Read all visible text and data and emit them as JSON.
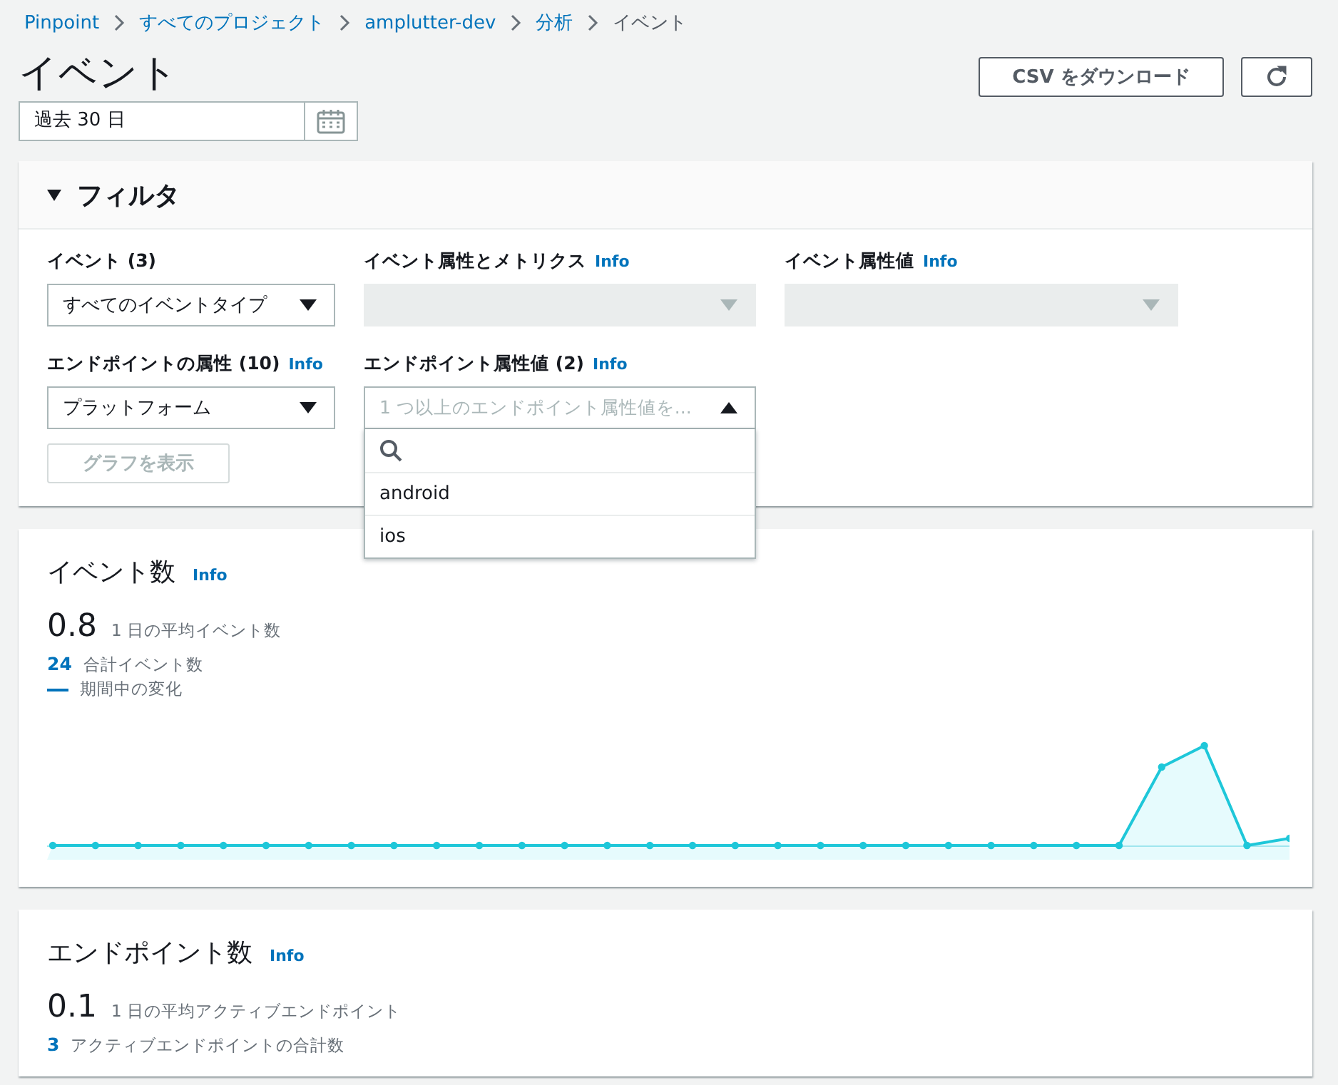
{
  "breadcrumb": [
    {
      "label": "Pinpoint",
      "link": true
    },
    {
      "label": "すべてのプロジェクト",
      "link": true
    },
    {
      "label": "amplutter-dev",
      "link": true
    },
    {
      "label": "分析",
      "link": true
    },
    {
      "label": "イベント",
      "link": false
    }
  ],
  "page_title": "イベント",
  "header_buttons": {
    "download": "CSV をダウンロード"
  },
  "date_range": {
    "value": "過去 30 日"
  },
  "filter": {
    "title": "フィルタ",
    "expanded": true,
    "fields": [
      {
        "label": "イベント (3)",
        "value": "すべてのイベントタイプ",
        "disabled": false
      },
      {
        "label": "イベント属性とメトリクス",
        "info": "Info",
        "disabled": true
      },
      {
        "label": "イベント属性値",
        "info": "Info",
        "disabled": true
      },
      {
        "label": "エンドポイントの属性 (10)",
        "info": "Info",
        "value": "プラットフォーム",
        "disabled": false
      },
      {
        "label": "エンドポイント属性値 (2)",
        "info": "Info",
        "placeholder": "1 つ以上のエンドポイント属性値を...",
        "disabled": false,
        "expanded": true,
        "options": [
          "android",
          "ios"
        ]
      }
    ],
    "show_graph_button": {
      "label": "グラフを表示",
      "disabled": true
    }
  },
  "cards": [
    {
      "title": "イベント数",
      "info": "Info",
      "big": "0.8",
      "big_label": "1 日の平均イベント数",
      "total": "24",
      "total_label": "合計イベント数",
      "legend": "期間中の変化",
      "chart": true
    },
    {
      "title": "エンドポイント数",
      "info": "Info",
      "big": "0.1",
      "big_label": "1 日の平均アクティブエンドポイント",
      "total": "3",
      "total_label": "アクティブエンドポイントの合計数",
      "chart": false
    }
  ]
}
